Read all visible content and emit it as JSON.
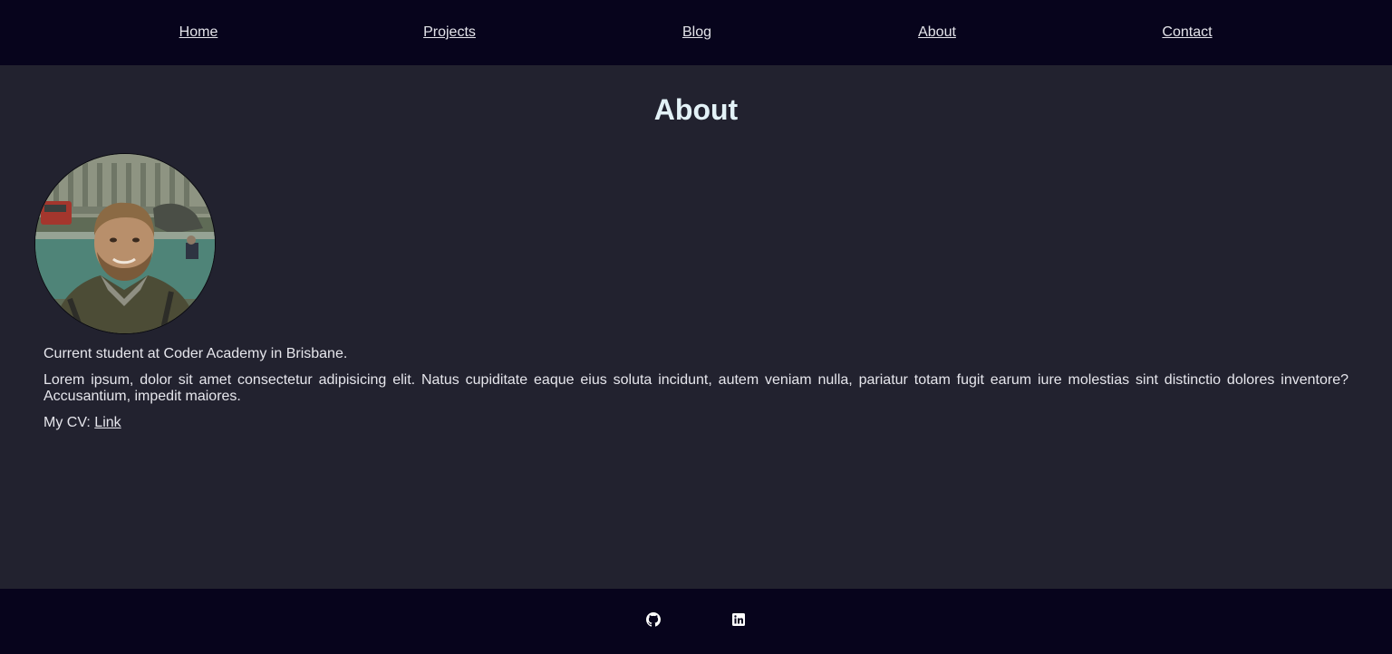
{
  "nav": {
    "items": [
      {
        "label": "Home"
      },
      {
        "label": "Projects"
      },
      {
        "label": "Blog"
      },
      {
        "label": "About"
      },
      {
        "label": "Contact"
      }
    ]
  },
  "page": {
    "title": "About"
  },
  "profile": {
    "avatar_alt": "profile-photo"
  },
  "content": {
    "intro": "Current student at Coder Academy in Brisbane.",
    "lorem": "Lorem ipsum, dolor sit amet consectetur adipisicing elit. Natus cupiditate eaque eius soluta incidunt, autem veniam nulla, pariatur totam fugit earum iure molestias sint distinctio dolores inventore? Accusantium, impedit maiores.",
    "cv_prefix": "My CV: ",
    "cv_link": "Link"
  },
  "footer": {
    "icons": [
      "github-icon",
      "linkedin-icon"
    ]
  },
  "colors": {
    "nav_bg": "#07041c",
    "page_bg": "#22222f",
    "title": "#e3f2f7",
    "text": "#e6e6ec"
  }
}
